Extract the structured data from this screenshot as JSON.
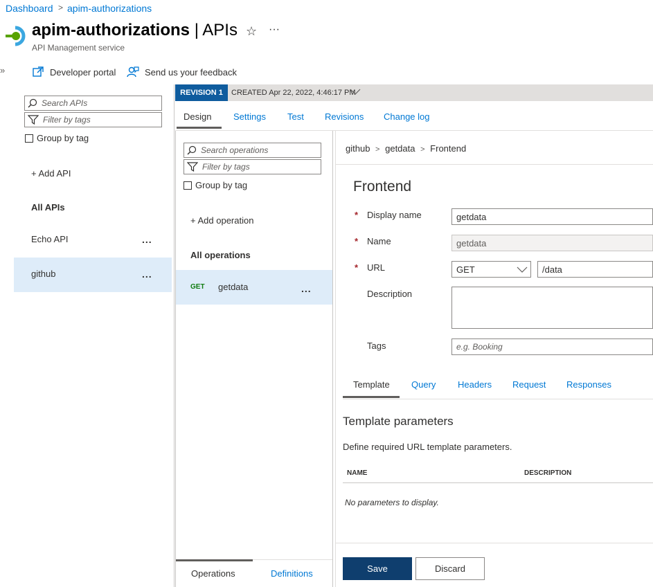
{
  "breadcrumb": {
    "home": "Dashboard",
    "separator": ">",
    "current": "apim-authorizations"
  },
  "header": {
    "title": "apim-authorizations",
    "section": "| APIs",
    "subtitle": "API Management service",
    "star": "☆",
    "more": "···",
    "collapse": "»"
  },
  "toolbar": {
    "developer_portal": "Developer portal",
    "feedback": "Send us your feedback"
  },
  "revision": {
    "badge": "REVISION 1",
    "created": "CREATED Apr 22, 2022, 4:46:17 PM"
  },
  "top_tabs": [
    "Design",
    "Settings",
    "Test",
    "Revisions",
    "Change log"
  ],
  "api_list": {
    "search_placeholder": "Search APIs",
    "filter_placeholder": "Filter by tags",
    "group_by_tag": "Group by tag",
    "add_api": "+ Add API",
    "all_apis": "All APIs",
    "items": [
      {
        "name": "Echo API",
        "more": "..."
      },
      {
        "name": "github",
        "more": "..."
      }
    ]
  },
  "operations": {
    "search_placeholder": "Search operations",
    "filter_placeholder": "Filter by tags",
    "group_by_tag": "Group by tag",
    "add_operation": "+ Add operation",
    "all_operations": "All operations",
    "items": [
      {
        "method": "GET",
        "name": "getdata",
        "more": "..."
      }
    ],
    "bottom_tabs": [
      "Operations",
      "Definitions"
    ]
  },
  "detail": {
    "breadcrumb": {
      "api": "github",
      "operation": "getdata",
      "section": "Frontend",
      "sep": ">"
    },
    "heading": "Frontend",
    "required_mark": "*",
    "fields": {
      "display_name": {
        "label": "Display name",
        "value": "getdata"
      },
      "name": {
        "label": "Name",
        "value": "getdata"
      },
      "url": {
        "label": "URL",
        "method": "GET",
        "path": "/data"
      },
      "description": {
        "label": "Description",
        "value": ""
      },
      "tags": {
        "label": "Tags",
        "placeholder": "e.g. Booking"
      }
    },
    "sub_tabs": [
      "Template",
      "Query",
      "Headers",
      "Request",
      "Responses"
    ],
    "template": {
      "heading": "Template parameters",
      "description": "Define required URL template parameters.",
      "columns": [
        "NAME",
        "DESCRIPTION"
      ],
      "empty": "No parameters to display."
    },
    "actions": {
      "save": "Save",
      "discard": "Discard"
    }
  },
  "colors": {
    "accent": "#0078d4",
    "revision_badge": "#0f5c9e",
    "primary_button": "#0f3e6e",
    "selected_row": "#deecf9"
  }
}
